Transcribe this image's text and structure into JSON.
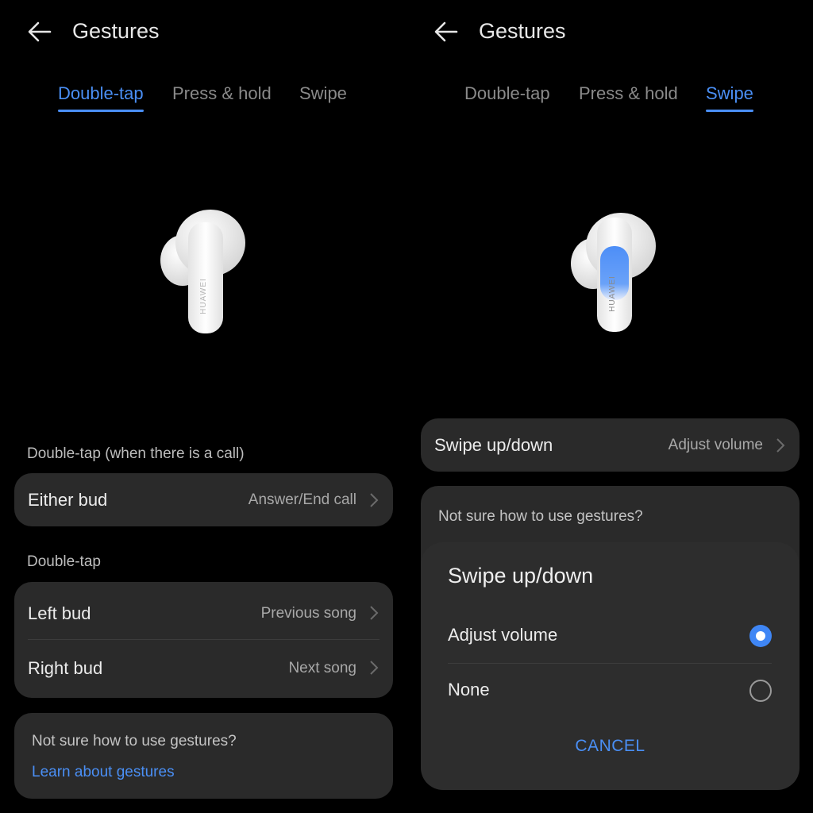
{
  "colors": {
    "accent": "#4a8ff5",
    "card": "#2a2a2a",
    "background": "#000000",
    "swipe_zone": "#4d8ef7"
  },
  "icons": {
    "back": "arrow-left-icon",
    "chevron": "chevron-right-icon",
    "earbud_brand": "HUAWEI"
  },
  "left": {
    "title": "Gestures",
    "tabs": [
      {
        "label": "Double-tap",
        "active": true
      },
      {
        "label": "Press & hold",
        "active": false
      },
      {
        "label": "Swipe",
        "active": false
      }
    ],
    "call_section": {
      "label": "Double-tap (when there is a call)",
      "rows": [
        {
          "label": "Either bud",
          "value": "Answer/End call"
        }
      ]
    },
    "tap_section": {
      "label": "Double-tap",
      "rows": [
        {
          "label": "Left bud",
          "value": "Previous song"
        },
        {
          "label": "Right bud",
          "value": "Next song"
        }
      ]
    },
    "help": {
      "question": "Not sure how to use gestures?",
      "link": "Learn about gestures"
    }
  },
  "right": {
    "title": "Gestures",
    "tabs": [
      {
        "label": "Double-tap",
        "active": false
      },
      {
        "label": "Press & hold",
        "active": false
      },
      {
        "label": "Swipe",
        "active": true
      }
    ],
    "swipe_row": {
      "label": "Swipe up/down",
      "value": "Adjust volume"
    },
    "help": {
      "question": "Not sure how to use gestures?"
    },
    "dialog": {
      "title": "Swipe up/down",
      "options": [
        {
          "label": "Adjust volume",
          "selected": true
        },
        {
          "label": "None",
          "selected": false
        }
      ],
      "cancel": "CANCEL"
    }
  }
}
